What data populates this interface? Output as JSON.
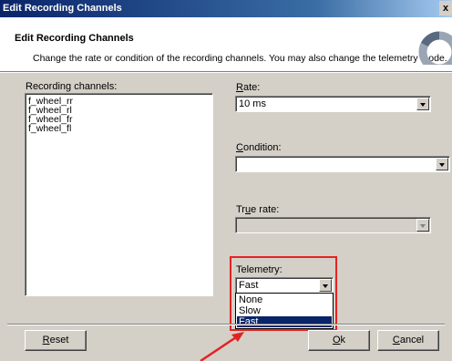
{
  "window": {
    "title": "Edit Recording Channels",
    "close_glyph": "x"
  },
  "header": {
    "title": "Edit Recording Channels",
    "subtitle": "Change the rate or condition of the recording channels. You may also change the telemetry mode."
  },
  "channels": {
    "label": "Recording channels:",
    "items": [
      "f_wheel_rr",
      "f_wheel_rl",
      "f_wheel_fr",
      "f_wheel_fl"
    ]
  },
  "rate": {
    "label_underlined": "R",
    "label_rest": "ate:",
    "value": "10 ms"
  },
  "condition": {
    "label_underlined": "C",
    "label_rest": "ondition:",
    "value": ""
  },
  "true_rate": {
    "label_pre": "Tr",
    "label_underlined": "u",
    "label_rest": "e rate:",
    "value": ""
  },
  "telemetry": {
    "label": "Telemetry:",
    "value": "Fast",
    "options": [
      "None",
      "Slow",
      "Fast"
    ],
    "selected_option": "Fast"
  },
  "buttons": {
    "reset_underlined": "R",
    "reset_rest": "eset",
    "ok_underlined": "O",
    "ok_rest": "k",
    "cancel_underlined": "C",
    "cancel_rest": "ancel"
  },
  "colors": {
    "highlight": "#e32323",
    "selection": "#0a246a",
    "titlebar": "#0a246a"
  }
}
